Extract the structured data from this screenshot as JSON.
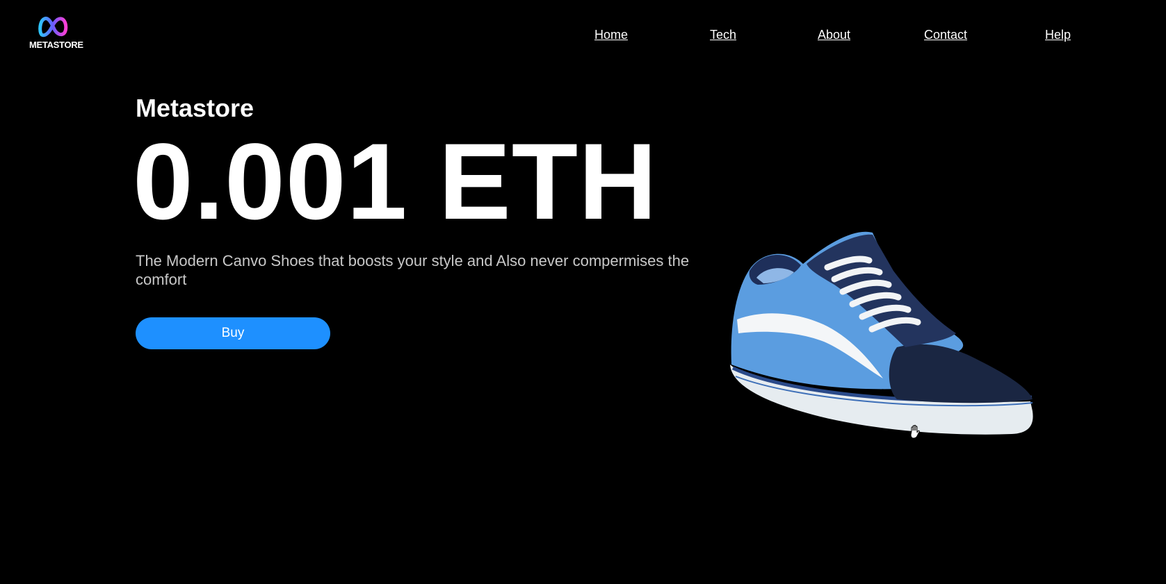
{
  "brand": {
    "logo_text": "METASTORE",
    "logo_icon": "infinity-logo-icon",
    "gradient_colors": [
      "#2ec5ff",
      "#6a5cff",
      "#ff3fd4"
    ]
  },
  "nav": {
    "items": [
      {
        "label": "Home"
      },
      {
        "label": "Tech"
      },
      {
        "label": "About"
      },
      {
        "label": "Contact"
      },
      {
        "label": "Help"
      }
    ]
  },
  "hero": {
    "subtitle": "Metastore",
    "price": "0.001 ETH",
    "description": "The Modern Canvo Shoes that boosts your style and Also never compermises the comfort",
    "buy_label": "Buy",
    "button_color": "#1e90ff"
  },
  "product": {
    "image": "blue-canvas-sneaker",
    "cursor_icon": "hand-grab-icon"
  }
}
